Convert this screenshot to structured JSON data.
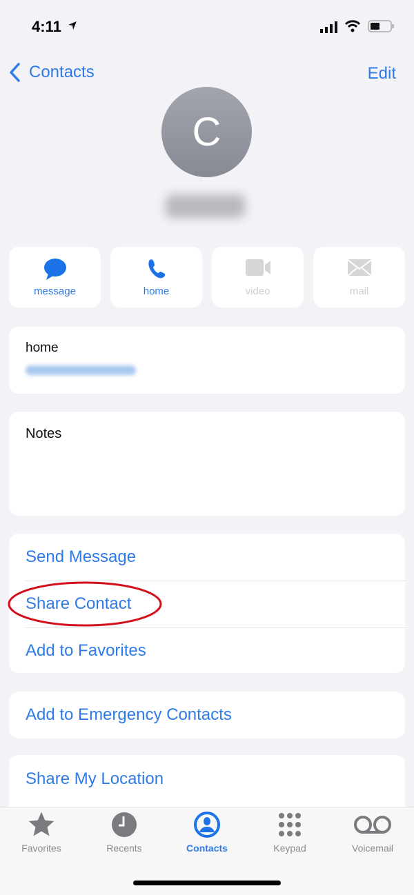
{
  "status_bar": {
    "time": "4:11"
  },
  "nav": {
    "back_label": "Contacts",
    "edit_label": "Edit"
  },
  "contact": {
    "initial": "C"
  },
  "actions": [
    {
      "label": "message",
      "icon": "message-bubble-icon",
      "enabled": true
    },
    {
      "label": "home",
      "icon": "phone-icon",
      "enabled": true
    },
    {
      "label": "video",
      "icon": "video-camera-icon",
      "enabled": false
    },
    {
      "label": "mail",
      "icon": "envelope-icon",
      "enabled": false
    }
  ],
  "phone_card": {
    "label": "home"
  },
  "notes_card": {
    "label": "Notes"
  },
  "action_list": [
    {
      "label": "Send Message"
    },
    {
      "label": "Share Contact",
      "highlighted": true
    },
    {
      "label": "Add to Favorites"
    }
  ],
  "emergency": {
    "label": "Add to Emergency Contacts"
  },
  "location": {
    "label": "Share My Location"
  },
  "tabs": [
    {
      "label": "Favorites",
      "icon": "star-icon",
      "active": false
    },
    {
      "label": "Recents",
      "icon": "clock-icon",
      "active": false
    },
    {
      "label": "Contacts",
      "icon": "person-circle-icon",
      "active": true
    },
    {
      "label": "Keypad",
      "icon": "keypad-icon",
      "active": false
    },
    {
      "label": "Voicemail",
      "icon": "voicemail-icon",
      "active": false
    }
  ],
  "colors": {
    "accent": "#2f7be6",
    "highlight": "#d4111b",
    "background": "#f2f2f7"
  }
}
